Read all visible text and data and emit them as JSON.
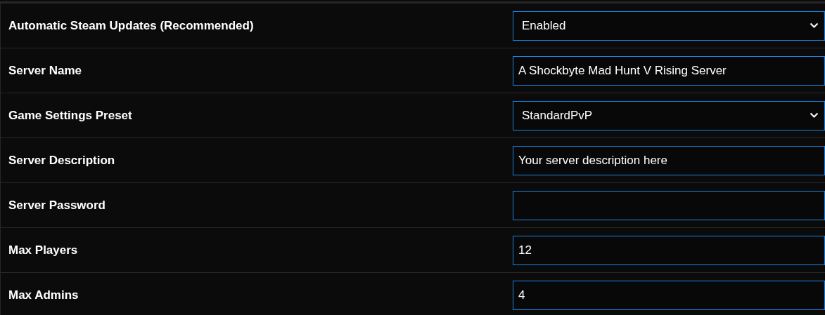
{
  "settings": [
    {
      "label": "Automatic Steam Updates (Recommended)",
      "kind": "select",
      "value": "Enabled"
    },
    {
      "label": "Server Name",
      "kind": "text",
      "value": "A Shockbyte Mad Hunt V Rising Server"
    },
    {
      "label": "Game Settings Preset",
      "kind": "select",
      "value": "StandardPvP"
    },
    {
      "label": "Server Description",
      "kind": "text",
      "value": "Your server description here"
    },
    {
      "label": "Server Password",
      "kind": "text"
    },
    {
      "label": "Max Players",
      "kind": "text",
      "value": "12"
    },
    {
      "label": "Max Admins",
      "kind": "text",
      "value": "4"
    }
  ]
}
